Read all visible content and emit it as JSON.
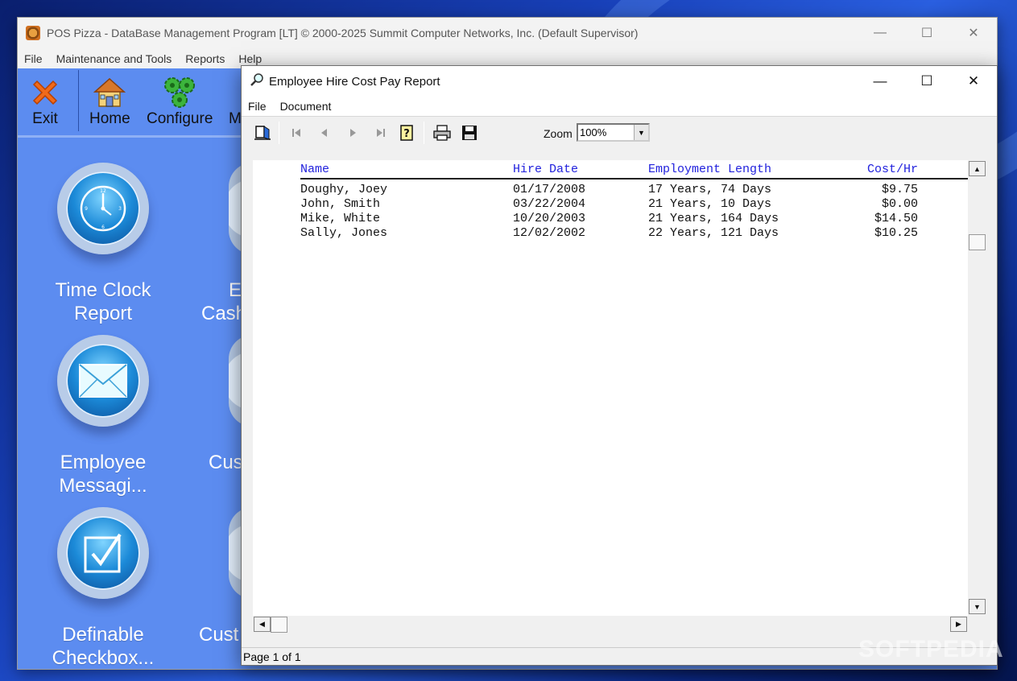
{
  "main_window": {
    "title": "POS Pizza - DataBase Management Program  [LT]  © 2000-2025 Summit Computer Networks, Inc.   (Default Supervisor)",
    "controls": {
      "minimize": "—",
      "maximize": "☐",
      "close": "✕"
    },
    "menu": [
      "File",
      "Maintenance and Tools",
      "Reports",
      "Help"
    ],
    "toolbar": {
      "exit_label": "Exit",
      "home_label": "Home",
      "configure_label": "Configure",
      "partial_label": "M"
    },
    "tiles": [
      {
        "label_line1": "Time Clock",
        "label_line2": "Report",
        "icon": "clock-icon"
      },
      {
        "label_line1": "Employee",
        "label_line2": "Messagi...",
        "icon": "envelope-icon"
      },
      {
        "label_line1": "Definable",
        "label_line2": "Checkbox...",
        "icon": "checkbox-icon"
      }
    ],
    "partial_tiles": [
      {
        "line1": "E",
        "line2": "Cash"
      },
      {
        "line1": "Cus",
        "line2": ""
      },
      {
        "line1": "Cust",
        "line2": ""
      }
    ]
  },
  "report_window": {
    "title": "Employee Hire Cost Pay Report",
    "controls": {
      "minimize": "—",
      "maximize": "☐",
      "close": "✕"
    },
    "menu": [
      "File",
      "Document"
    ],
    "toolbar": {
      "icons": [
        "open-book-icon",
        "first-page-icon",
        "prev-page-icon",
        "next-page-icon",
        "last-page-icon",
        "help-icon",
        "print-icon",
        "save-icon"
      ],
      "zoom_label": "Zoom",
      "zoom_value": "100%"
    },
    "report": {
      "columns": [
        "Name",
        "Hire Date",
        "Employment Length",
        "Cost/Hr"
      ],
      "rows": [
        [
          "Doughy, Joey",
          "01/17/2008",
          "17 Years, 74 Days",
          "$9.75"
        ],
        [
          "John, Smith",
          "03/22/2004",
          "21 Years, 10 Days",
          "$0.00"
        ],
        [
          "Mike, White",
          "10/20/2003",
          "21 Years, 164 Days",
          "$14.50"
        ],
        [
          "Sally, Jones",
          "12/02/2002",
          "22 Years, 121 Days",
          "$10.25"
        ]
      ]
    },
    "status": "Page 1 of 1"
  },
  "watermark": "SOFTPEDIA",
  "colors": {
    "panel_blue": "#5c8cf0",
    "header_text": "#2222dd"
  }
}
